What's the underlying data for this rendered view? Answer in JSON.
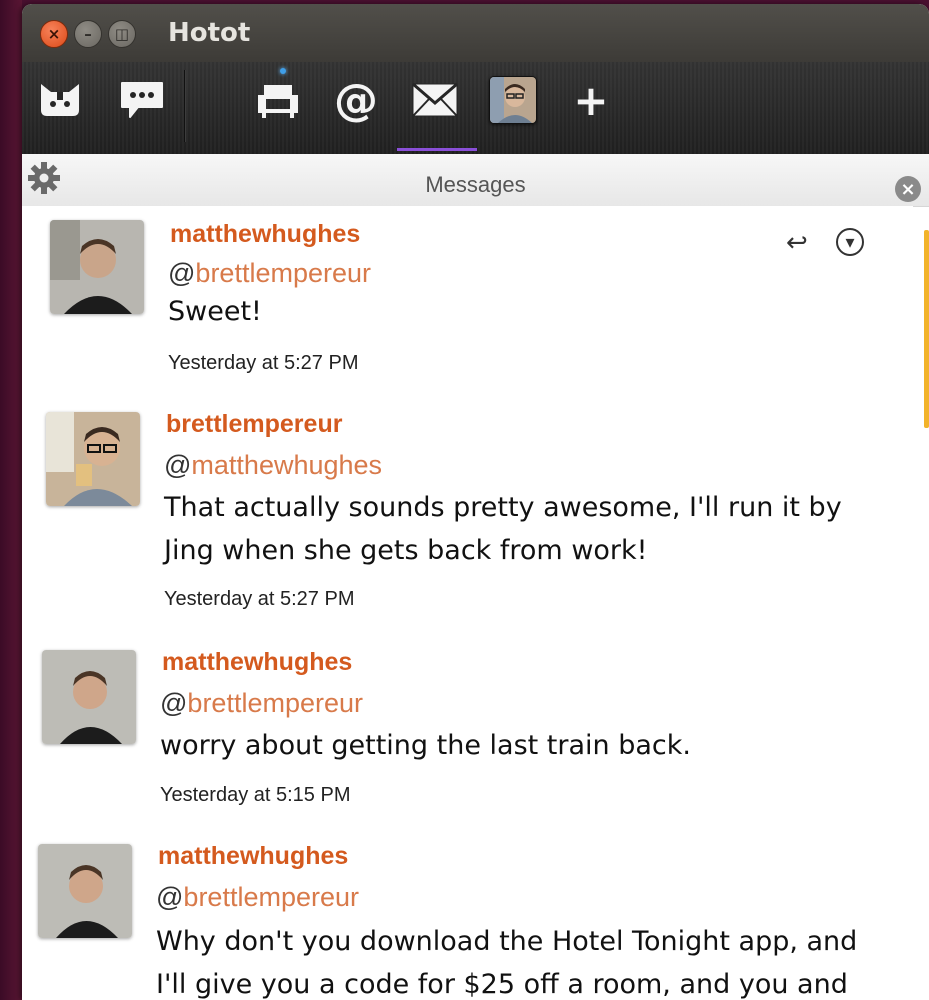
{
  "window": {
    "title": "Hotot",
    "close_glyph": "×",
    "min_glyph": "–",
    "max_glyph": "◫"
  },
  "toolbar": {
    "icons": [
      "hotot-logo-icon",
      "chat-bubble-icon",
      "home-couch-icon",
      "mention-at-icon",
      "messages-envelope-icon",
      "profile-avatar",
      "add-column-icon"
    ],
    "at_glyph": "@",
    "plus_glyph": "+",
    "active_tab": "messages"
  },
  "column": {
    "title": "Messages",
    "close_glyph": "×"
  },
  "messages": [
    {
      "username": "matthewhughes",
      "mention_prefix": "@",
      "mention_name": "brettlempereur",
      "text": "Sweet!",
      "time": "Yesterday at 5:27 PM",
      "avatar": "matthewhughes-avatar"
    },
    {
      "username": "brettlempereur",
      "mention_prefix": "@",
      "mention_name": "matthewhughes",
      "text": "That actually sounds pretty awesome, I'll run it by Jing when she gets back from work!",
      "time": "Yesterday at 5:27 PM",
      "avatar": "brettlempereur-avatar"
    },
    {
      "username": "matthewhughes",
      "mention_prefix": "@",
      "mention_name": "brettlempereur",
      "text": "worry about getting the last train back.",
      "time": "Yesterday at 5:15 PM",
      "avatar": "matthewhughes-avatar"
    },
    {
      "username": "matthewhughes",
      "mention_prefix": "@",
      "mention_name": "brettlempereur",
      "text": "Why don't you download the Hotel Tonight app, and I'll give you a code for $25 off a room, and you and",
      "time": "",
      "avatar": "matthewhughes-avatar"
    }
  ],
  "actions": {
    "reply_glyph": "↩",
    "more_glyph": "▾"
  },
  "colors": {
    "username": "#d45a1e",
    "mention": "#d87a4a",
    "scroll_accent": "#f2b32a",
    "tab_underline": "#8a4fd8",
    "toolbar_bg": "#262626",
    "titlebar_bg": "#46443f"
  }
}
